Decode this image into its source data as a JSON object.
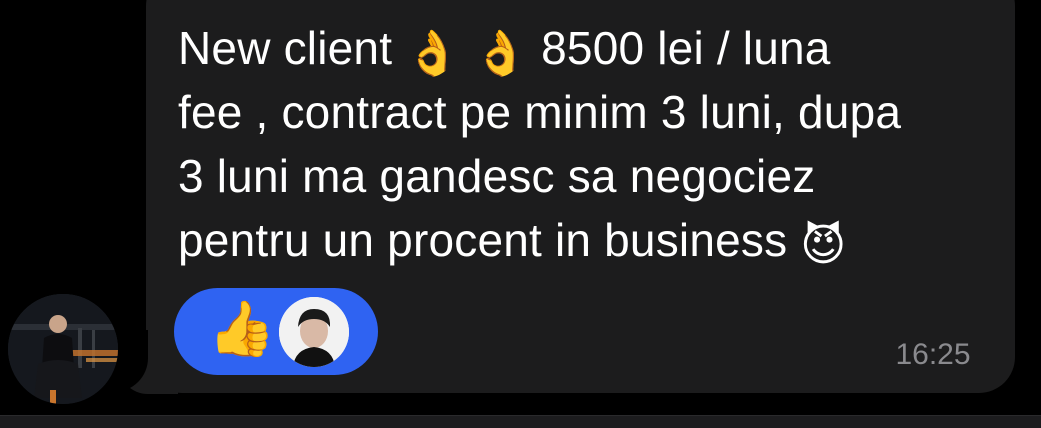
{
  "message": {
    "lines": [
      {
        "before": "New client ",
        "emoji": [
          "👌",
          "👌"
        ],
        "after": " 8500 lei / luna"
      },
      {
        "text": "fee , contract pe minim 3 luni, dupa"
      },
      {
        "text": "3 luni ma gandesc sa negociez"
      },
      {
        "before": "pentru un procent in business ",
        "emoji": [
          "😈"
        ]
      }
    ],
    "time": "16:25"
  },
  "reaction": {
    "emoji": "👍",
    "icon": "thumbs-up-icon",
    "color": "#2f63f2"
  },
  "colors": {
    "background": "#000000",
    "bubble": "#1c1c1d",
    "text": "#ffffff",
    "timestamp": "#8a8a8e"
  }
}
